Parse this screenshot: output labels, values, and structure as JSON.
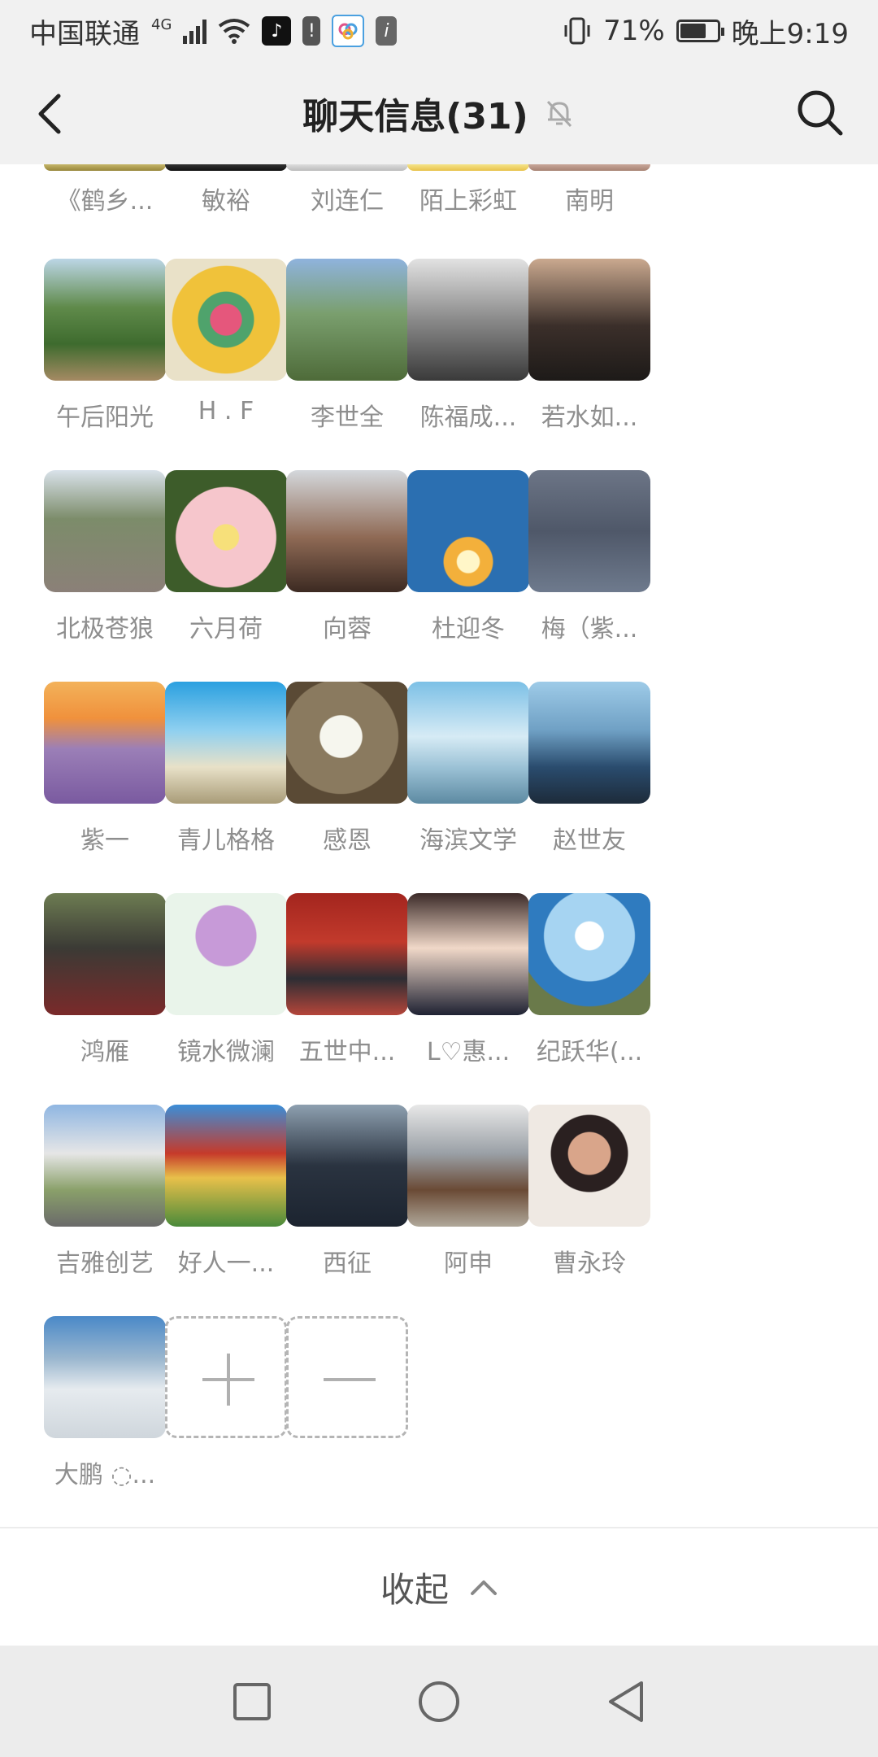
{
  "status_bar": {
    "carrier": "中国联通",
    "network": "4G",
    "battery_percent": "71%",
    "battery_level": 0.71,
    "time": "晚上9:19",
    "tiktok_glyph": "♪",
    "notice_glyph": "!",
    "info_glyph": "i"
  },
  "header": {
    "title": "聊天信息(31)"
  },
  "members": [
    {
      "name": "《鹤乡...",
      "cut": true,
      "bg": "linear-gradient(#c6b66a,#97863a)"
    },
    {
      "name": "敏裕",
      "cut": true,
      "bg": "linear-gradient(#333,#111)"
    },
    {
      "name": "刘连仁",
      "cut": true,
      "bg": "linear-gradient(#ddd,#bbb)"
    },
    {
      "name": "陌上彩虹",
      "cut": true,
      "bg": "linear-gradient(#f5e48a,#e8c24a)"
    },
    {
      "name": "南明",
      "cut": true,
      "bg": "linear-gradient(#c9a79a,#a78373)"
    },
    {
      "name": "午后阳光",
      "bg": "linear-gradient(180deg,#bcd6e6 0%,#5f8a4a 40%,#3e6b2e 70%,#a58a63 100%)"
    },
    {
      "name": "H . F",
      "bg": "radial-gradient(circle at 50% 50%,#e5577c 0 18%,#4fa36c 19% 32%,#f0c23a 33% 62%,#e9e1c8 63% 100%)"
    },
    {
      "name": "李世全",
      "bg": "linear-gradient(180deg,#8fb3dd 0%,#7a9f6e 45%,#4e6b39 100%)"
    },
    {
      "name": "陈福成...",
      "bg": "linear-gradient(180deg,#e2e2e2 0%,#8a8a8a 50%,#3a3a3a 100%)"
    },
    {
      "name": "若水如...",
      "bg": "linear-gradient(180deg,#caa98f 0%,#3b2f2a 55%,#1d1a18 100%)"
    },
    {
      "name": "北极苍狼",
      "bg": "linear-gradient(180deg,#d9e2ea 0%,#7c8c6a 40%,#8b8078 100%)"
    },
    {
      "name": "六月荷",
      "bg": "radial-gradient(circle at 50% 55%,#f7e07a 0 14%,#f6c6cc 15% 55%,#3d5c2a 56% 100%)"
    },
    {
      "name": "向蓉",
      "bg": "linear-gradient(180deg,#d4d8dc 0%,#8f6a55 55%,#3c2a22 100%)"
    },
    {
      "name": "杜迎冬",
      "bg": "radial-gradient(circle at 50% 75%,#fff6c8 0 10%,#f3b03b 11% 22%,#2b6fb1 23% 100%)"
    },
    {
      "name": "梅（紫...",
      "bg": "linear-gradient(180deg,#6c7586 0%,#4f5869 50%,#6e7a8d 100%)"
    },
    {
      "name": "紫一",
      "bg": "linear-gradient(180deg,#f3b25a 0%,#f0913c 30%,#9b7fb7 55%,#7a5aa0 100%)"
    },
    {
      "name": "青儿格格",
      "bg": "linear-gradient(180deg,#2aa0e0 0%,#8fd0f0 40%,#e8e1c8 70%,#a99c78 100%)"
    },
    {
      "name": "感恩",
      "bg": "radial-gradient(circle at 45% 45%,#f6f6ee 0 22%,#8a7a5f 23% 60%,#5a4a35 61% 100%)"
    },
    {
      "name": "海滨文学",
      "bg": "linear-gradient(180deg,#7cc0e6 0%,#d6ebf5 45%,#9cc2d6 70%,#5d8aa2 100%)"
    },
    {
      "name": "赵世友",
      "bg": "linear-gradient(180deg,#9ecbe8 0%,#6fa0c4 40%,#2a4c6e 70%,#1d2b3a 100%)"
    },
    {
      "name": "鸿雁",
      "bg": "linear-gradient(180deg,#6d7c52 0%,#3b3a35 45%,#7a2a2a 100%)"
    },
    {
      "name": "镜水微澜",
      "bg": "radial-gradient(circle at 50% 35%,#c79ad8 0 30%,#e9f4ea 31% 100%)"
    },
    {
      "name": "五世中...",
      "bg": "linear-gradient(180deg,#a3251e 0%,#c23a2c 40%,#2d2d33 70%,#b5453a 100%)"
    },
    {
      "name": "L♡惠...",
      "bg": "linear-gradient(180deg,#3b2a28 0%,#f0d8c8 45%,#1f2233 100%)"
    },
    {
      "name": "纪跃华(...",
      "bg": "radial-gradient(circle at 50% 35%,#ffffff 0 14%,#a6d4f2 15% 45%,#2f7bbf 46% 70%,#6a7a4a 71% 100%)"
    },
    {
      "name": "吉雅创艺",
      "bg": "linear-gradient(180deg,#8fb6e2 0%,#e6e6e6 40%,#8aa06a 70%,#6a6a6a 100%)"
    },
    {
      "name": "好人一...",
      "bg": "linear-gradient(180deg,#3b8ed8 0%,#c63a2a 40%,#e8c04a 60%,#4a8a3a 100%)"
    },
    {
      "name": "西征",
      "bg": "linear-gradient(180deg,#8ea0b0 0%,#2a3340 50%,#1c2430 100%)"
    },
    {
      "name": "阿申",
      "bg": "linear-gradient(180deg,#e8e8e8 0%,#9aa0a6 40%,#6a4a35 70%,#b0a89a 100%)"
    },
    {
      "name": "曹永玲",
      "bg": "radial-gradient(circle at 50% 40%,#d9a58a 0 22%,#2a2020 23% 40%,#efe9e3 41% 100%)"
    },
    {
      "name": "大鹏 ◌...",
      "bg": "linear-gradient(180deg,#4a89c8 0%,#9bb7cf 35%,#e6ebef 60%,#cfd6dc 100%)"
    }
  ],
  "actions": {
    "add_label": "+",
    "remove_label": "−"
  },
  "collapse": {
    "label": "收起"
  }
}
